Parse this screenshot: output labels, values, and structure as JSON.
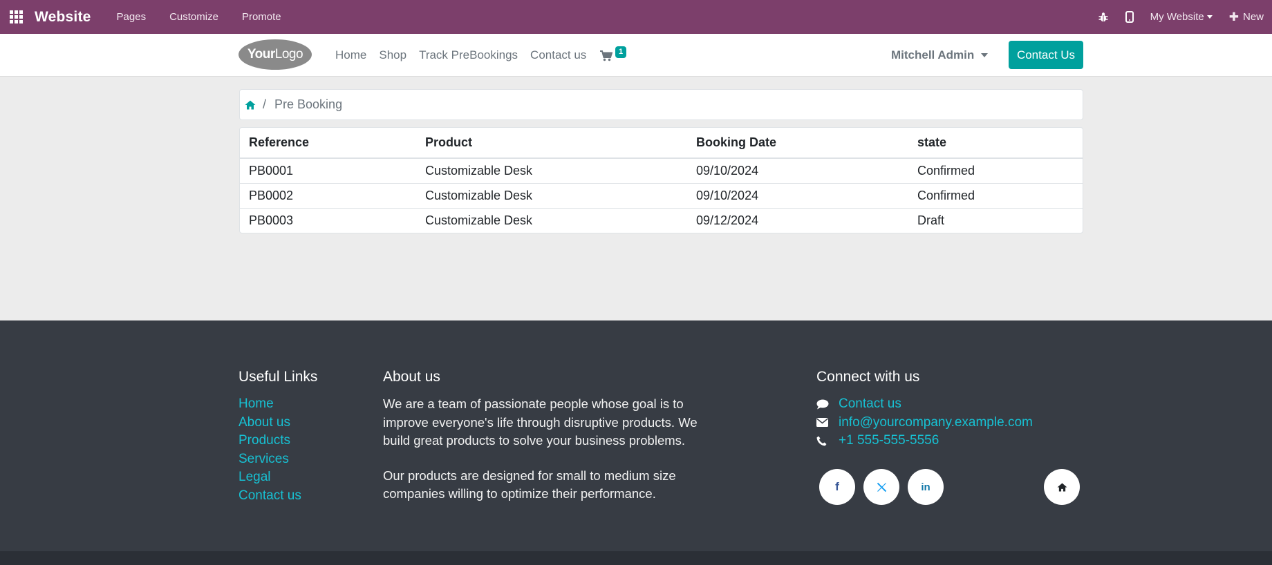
{
  "topbar": {
    "brand": "Website",
    "menu": [
      "Pages",
      "Customize",
      "Promote"
    ],
    "my_website": "My Website",
    "new": "New"
  },
  "header": {
    "logo_text_bold": "Your",
    "logo_text_light": "Logo",
    "nav": [
      "Home",
      "Shop",
      "Track PreBookings",
      "Contact us"
    ],
    "cart_count": "1",
    "user": "Mitchell Admin",
    "cta": "Contact Us"
  },
  "breadcrumb": {
    "separator": "/",
    "current": "Pre Booking"
  },
  "table": {
    "headers": [
      "Reference",
      "Product",
      "Booking Date",
      "state"
    ],
    "rows": [
      [
        "PB0001",
        "Customizable Desk",
        "09/10/2024",
        "Confirmed"
      ],
      [
        "PB0002",
        "Customizable Desk",
        "09/10/2024",
        "Confirmed"
      ],
      [
        "PB0003",
        "Customizable Desk",
        "09/12/2024",
        "Draft"
      ]
    ]
  },
  "footer": {
    "useful_links": {
      "title": "Useful Links",
      "items": [
        "Home",
        "About us",
        "Products",
        "Services",
        "Legal",
        "Contact us"
      ]
    },
    "about": {
      "title": "About us",
      "p1": "We are a team of passionate people whose goal is to improve everyone's life through disruptive products. We build great products to solve your business problems.",
      "p2": "Our products are designed for small to medium size companies willing to optimize their performance."
    },
    "connect": {
      "title": "Connect with us",
      "contact": "Contact us",
      "email": "info@yourcompany.example.com",
      "phone": "+1 555-555-5556"
    }
  },
  "colors": {
    "topbar": "#7c3f6b",
    "accent": "#00a09d",
    "footer": "#373c44",
    "link": "#17c1d3"
  },
  "icons": {
    "apps": "apps-grid-icon",
    "bug": "bug-icon",
    "mobile": "mobile-icon",
    "cart": "cart-icon",
    "home": "home-icon",
    "chat": "chat-icon",
    "email": "envelope-icon",
    "phone": "phone-icon",
    "facebook": "facebook-icon",
    "twitter": "x-twitter-icon",
    "linkedin": "linkedin-icon"
  }
}
